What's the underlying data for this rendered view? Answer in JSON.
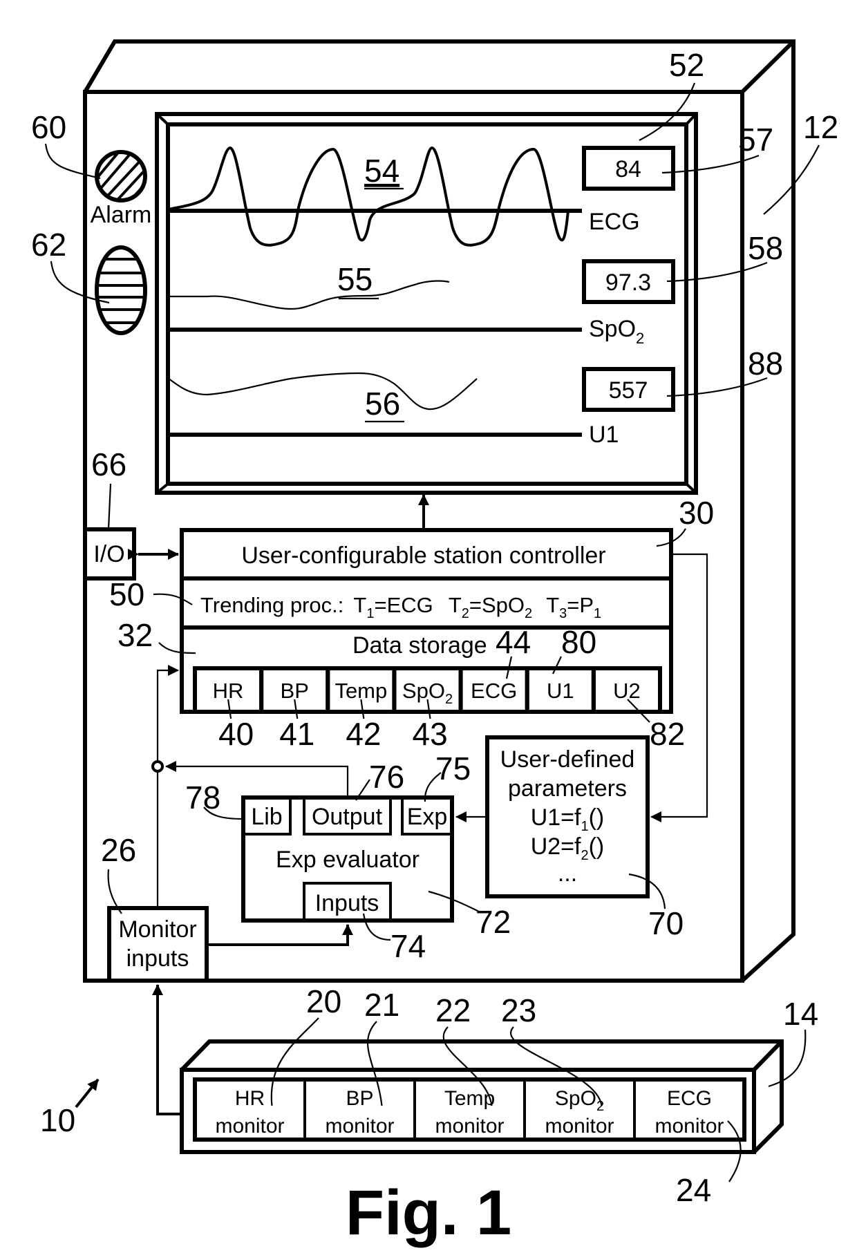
{
  "figure": {
    "caption": "Fig. 1",
    "system_ref": "10"
  },
  "station": {
    "ref": "12",
    "alarm": {
      "ref": "60",
      "label": "Alarm"
    },
    "speaker_ref": "62",
    "io": {
      "ref": "66",
      "label": "I/O"
    },
    "display": {
      "ref": "52",
      "traces": [
        {
          "ref": "54",
          "label": "ECG",
          "sub": "",
          "value": "84",
          "value_ref": "57"
        },
        {
          "ref": "55",
          "label": "SpO",
          "sub": "2",
          "value": "97.3",
          "value_ref": "58"
        },
        {
          "ref": "56",
          "label": "U1",
          "sub": "",
          "value": "557",
          "value_ref": "88"
        }
      ]
    },
    "controller": {
      "ref": "30",
      "title": "User-configurable station controller",
      "trending": {
        "ref": "50",
        "prefix": "Trending proc.:",
        "terms": [
          {
            "t": "T",
            "tsub": "1",
            "eq": "=ECG",
            "esub": ""
          },
          {
            "t": "T",
            "tsub": "2",
            "eq": "=SpO",
            "esub": "2"
          },
          {
            "t": "T",
            "tsub": "3",
            "eq": "=P",
            "esub": "1"
          }
        ]
      },
      "storage": {
        "ref": "32",
        "label": "Data storage",
        "cells": [
          {
            "label": "HR",
            "sub": "",
            "ref": "40"
          },
          {
            "label": "BP",
            "sub": "",
            "ref": "41"
          },
          {
            "label": "Temp",
            "sub": "",
            "ref": "42"
          },
          {
            "label": "SpO",
            "sub": "2",
            "ref": "43"
          },
          {
            "label": "ECG",
            "sub": "",
            "ref": "44"
          },
          {
            "label": "U1",
            "sub": "",
            "ref": "80"
          },
          {
            "label": "U2",
            "sub": "",
            "ref": "82"
          }
        ]
      }
    },
    "evaluator": {
      "ref": "72",
      "label": "Exp evaluator",
      "lib": {
        "ref": "78",
        "label": "Lib"
      },
      "output": {
        "ref": "76",
        "label": "Output"
      },
      "exp": {
        "ref": "75",
        "label": "Exp"
      },
      "inputs": {
        "ref": "74",
        "label": "Inputs"
      }
    },
    "user_params": {
      "ref": "70",
      "line1": "User-defined",
      "line2": "parameters",
      "u1": {
        "pre": "U1=f",
        "sub": "1",
        "post": "()"
      },
      "u2": {
        "pre": "U2=f",
        "sub": "2",
        "post": "()"
      },
      "more": "..."
    },
    "monitor_inputs": {
      "ref": "26",
      "line1": "Monitor",
      "line2": "inputs"
    }
  },
  "monitor_bank": {
    "ref": "14",
    "monitors": [
      {
        "name": "HR",
        "sub": "",
        "line2": "monitor",
        "ref": "20"
      },
      {
        "name": "BP",
        "sub": "",
        "line2": "monitor",
        "ref": "21"
      },
      {
        "name": "Temp",
        "sub": "",
        "line2": "monitor",
        "ref": "22"
      },
      {
        "name": "SpO",
        "sub": "2",
        "line2": "monitor",
        "ref": "23"
      },
      {
        "name": "ECG",
        "sub": "",
        "line2": "monitor",
        "ref": "24"
      }
    ]
  }
}
